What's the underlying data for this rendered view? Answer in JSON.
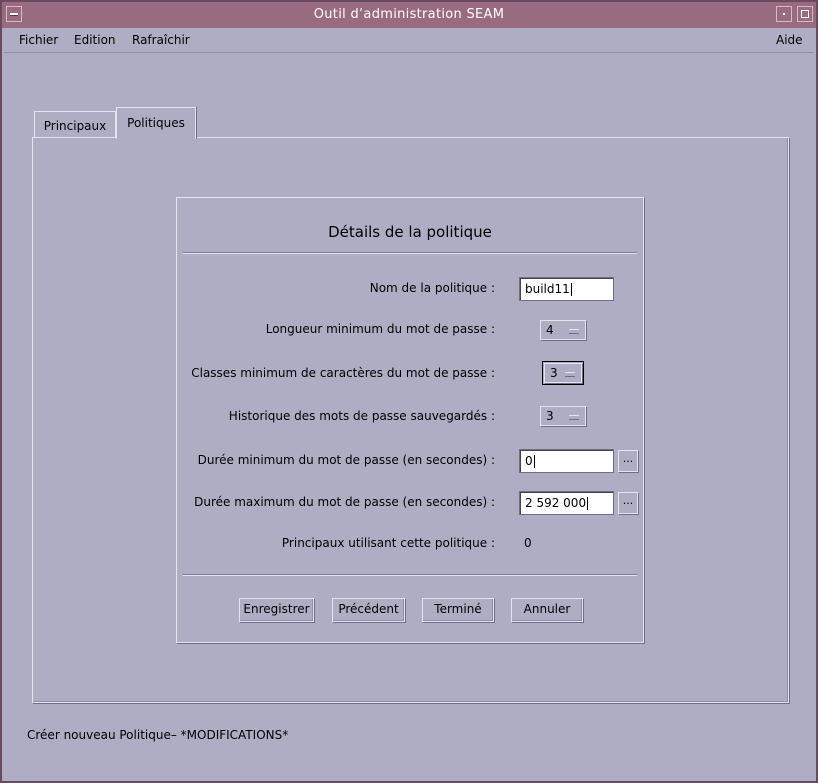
{
  "window": {
    "title": "Outil d’administration SEAM"
  },
  "menubar": {
    "file": "Fichier",
    "edit": "Edition",
    "refresh": "Rafraîchir",
    "help": "Aide"
  },
  "tabs": [
    {
      "label": "Principaux",
      "selected": false
    },
    {
      "label": "Politiques",
      "selected": true
    }
  ],
  "dialog": {
    "title": "Détails de la politique",
    "policy_name": {
      "label": "Nom de la politique :",
      "value": "build11"
    },
    "min_length": {
      "label": "Longueur minimum du mot de passe :",
      "value": "4"
    },
    "min_classes": {
      "label": "Classes minimum de caractères du mot de passe :",
      "value": "3"
    },
    "history": {
      "label": "Historique des mots de passe sauvegardés :",
      "value": "3"
    },
    "min_duration": {
      "label": "Durée minimum du mot de passe (en secondes) :",
      "value": "0",
      "button": "..."
    },
    "max_duration": {
      "label": "Durée maximum du mot de passe (en secondes) :",
      "value": "2 592 000",
      "button": "..."
    },
    "principals_using": {
      "label": "Principaux utilisant cette politique :",
      "value": "0"
    },
    "buttons": {
      "save": "Enregistrer",
      "previous": "Précédent",
      "done": "Terminé",
      "cancel": "Annuler"
    }
  },
  "status": {
    "text": "Créer nouveau Politique– *MODIFICATIONS*"
  }
}
